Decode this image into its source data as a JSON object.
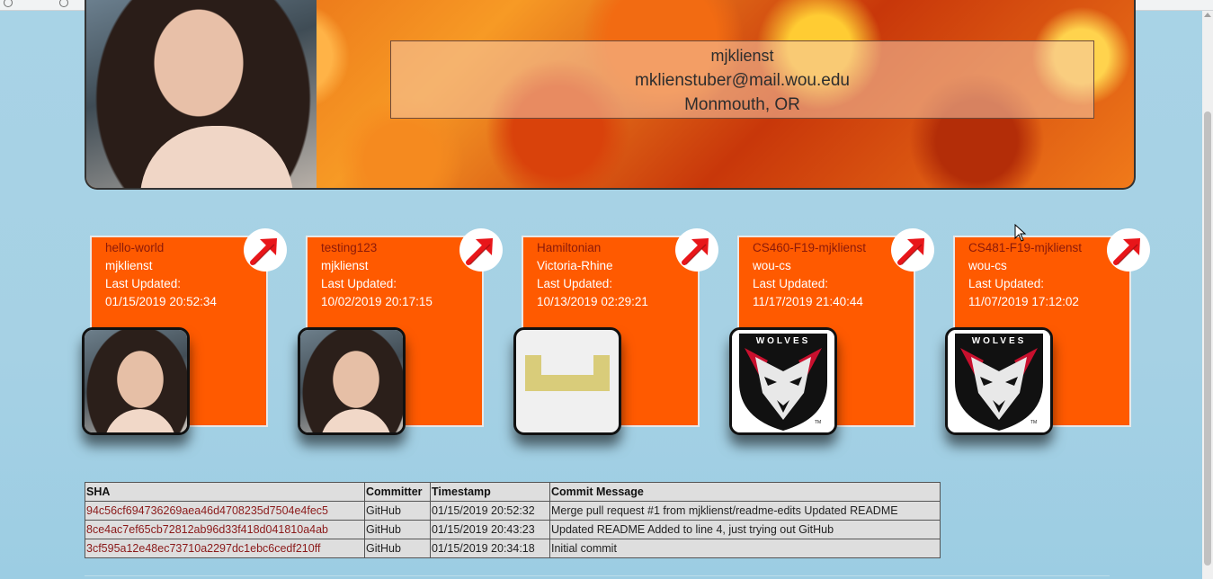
{
  "profile": {
    "username": "mjklienst",
    "email": "mklienstuber@mail.wou.edu",
    "location": "Monmouth, OR"
  },
  "repos": [
    {
      "name": "hello-world",
      "owner": "mjklienst",
      "updated_label": "Last Updated:",
      "updated": "01/15/2019 20:52:34",
      "icon": "user-photo"
    },
    {
      "name": "testing123",
      "owner": "mjklienst",
      "updated_label": "Last Updated:",
      "updated": "10/02/2019 20:17:15",
      "icon": "user-photo"
    },
    {
      "name": "Hamiltonian",
      "owner": "Victoria-Rhine",
      "updated_label": "Last Updated:",
      "updated": "10/13/2019 02:29:21",
      "icon": "identicon"
    },
    {
      "name": "CS460-F19-mjklienst",
      "owner": "wou-cs",
      "updated_label": "Last Updated:",
      "updated": "11/17/2019 21:40:44",
      "icon": "wolves-logo"
    },
    {
      "name": "CS481-F19-mjklienst",
      "owner": "wou-cs",
      "updated_label": "Last Updated:",
      "updated": "11/07/2019 17:12:02",
      "icon": "wolves-logo"
    }
  ],
  "logo_text": "WOLVES",
  "commits": {
    "headers": [
      "SHA",
      "Committer",
      "Timestamp",
      "Commit Message"
    ],
    "rows": [
      [
        "94c56cf694736269aea46d4708235d7504e4fec5",
        "GitHub",
        "01/15/2019 20:52:32",
        "Merge pull request #1 from mjklienst/readme-edits Updated README"
      ],
      [
        "8ce4ac7ef65cb72812ab96d33f418d041810a4ab",
        "GitHub",
        "01/15/2019 20:43:23",
        "Updated README Added to line 4, just trying out GitHub"
      ],
      [
        "3cf595a12e48ec73710a2297dc1ebc6cedf210ff",
        "GitHub",
        "01/15/2019 20:34:18",
        "Initial commit"
      ]
    ]
  },
  "colors": {
    "card": "#ff5a00",
    "page_bg": "#a8d3e6",
    "link": "#8b1a0a"
  }
}
